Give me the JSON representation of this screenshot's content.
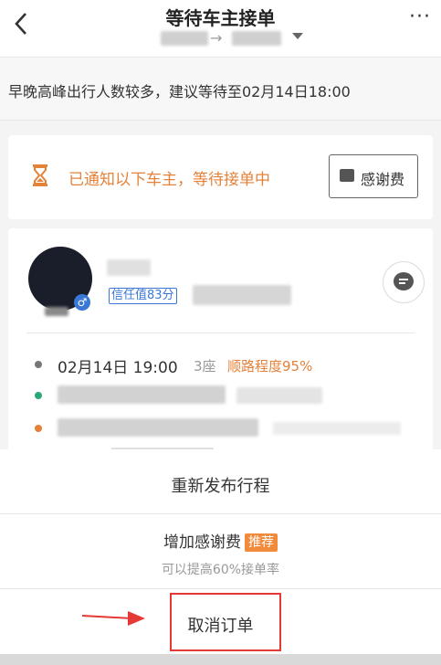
{
  "header": {
    "title": "等待车主接单",
    "route_arrow": "→",
    "more_label": "···"
  },
  "notice": {
    "text": "早晚高峰出行人数较多，建议等待至02月14日18:00"
  },
  "status_card": {
    "text": "已通知以下车主，等待接单中",
    "thank_button": "感谢费"
  },
  "driver_card": {
    "gender_symbol": "♂",
    "trust_label": "信任值83分",
    "time": "02月14日 19:00",
    "seats": "3座",
    "match": "顺路程度95%"
  },
  "sheet": {
    "republish": "重新发布行程",
    "add_fee": "增加感谢费",
    "recommend_tag": "推荐",
    "add_fee_sub": "可以提高60%接单率",
    "cancel": "取消订单"
  },
  "colors": {
    "accent_orange": "#e4823a",
    "trust_blue": "#3a78d6",
    "highlight_red": "#e53935"
  }
}
